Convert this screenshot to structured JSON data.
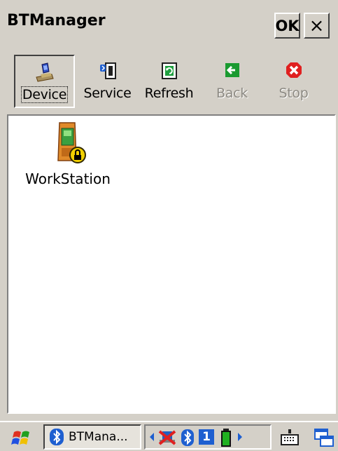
{
  "window": {
    "title": "BTManager"
  },
  "titlebar": {
    "ok_label": "OK",
    "close_label": "×"
  },
  "toolbar": {
    "items": [
      {
        "label": "Device",
        "icon": "device-icon",
        "state": "pressed"
      },
      {
        "label": "Service",
        "icon": "service-icon",
        "state": "enabled"
      },
      {
        "label": "Refresh",
        "icon": "refresh-icon",
        "state": "enabled"
      },
      {
        "label": "Back",
        "icon": "back-arrow-icon",
        "state": "disabled"
      },
      {
        "label": "Stop",
        "icon": "stop-icon",
        "state": "disabled"
      }
    ]
  },
  "devices": [
    {
      "name": "WorkStation",
      "icon": "locked-pda-icon"
    }
  ],
  "taskbar": {
    "task_label": "BTMana...",
    "tray_number": "1",
    "colors": {
      "bluetooth": "#1e5fd0",
      "battery": "#20b020",
      "stop": "#e02020",
      "back": "#1a9a30"
    }
  }
}
